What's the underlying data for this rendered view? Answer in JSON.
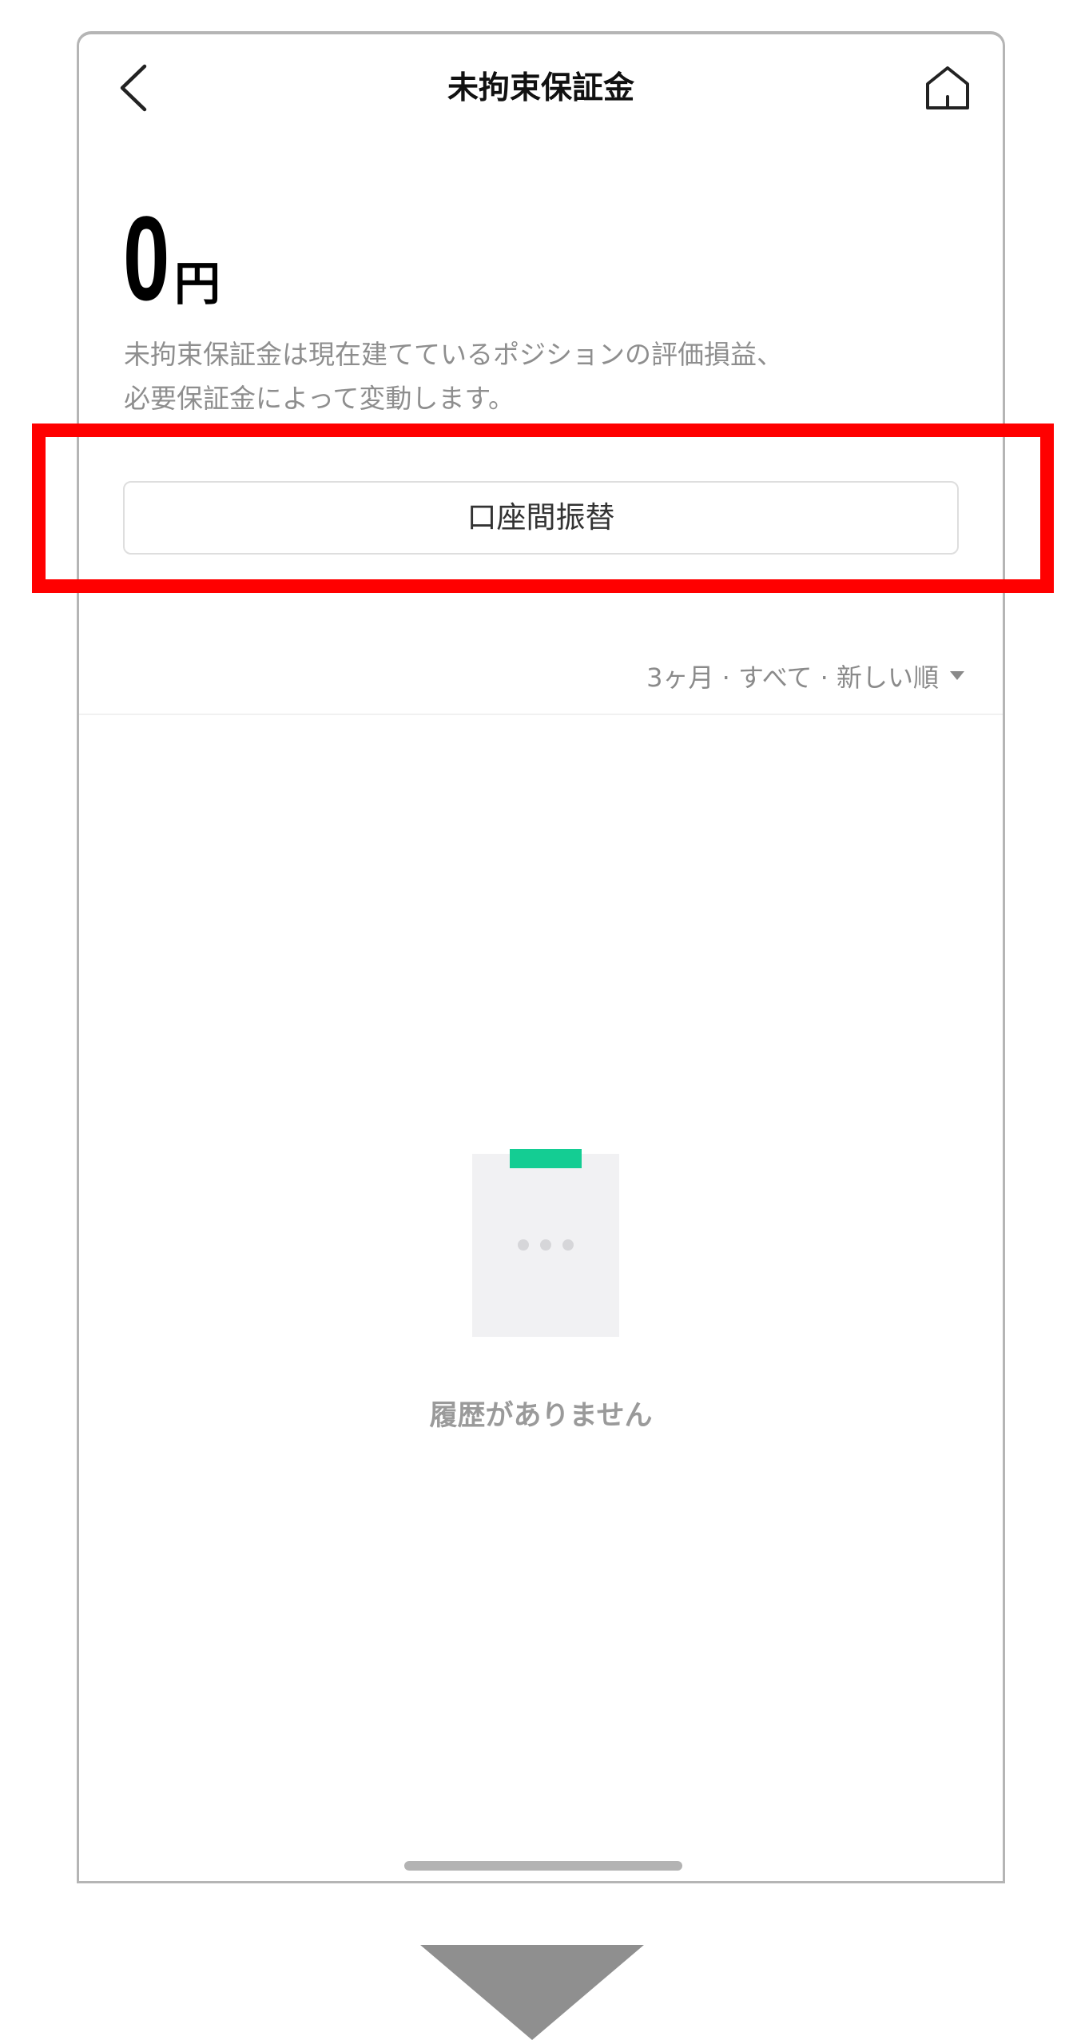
{
  "header": {
    "title": "未拘束保証金",
    "back_icon": "chevron-left-icon",
    "home_icon": "home-icon"
  },
  "balance": {
    "amount": "0",
    "unit": "円"
  },
  "description": {
    "line1": "未拘束保証金は現在建てているポジションの評価損益、",
    "line2": "必要保証金によって変動します。"
  },
  "transfer_button": {
    "label": "口座間振替"
  },
  "filter": {
    "label": "3ヶ月 · すべて · 新しい順"
  },
  "empty_state": {
    "message": "履歴がありません"
  },
  "colors": {
    "accent": "#14cd93",
    "highlight": "#ff0000",
    "muted_text": "#8e8e8e"
  }
}
